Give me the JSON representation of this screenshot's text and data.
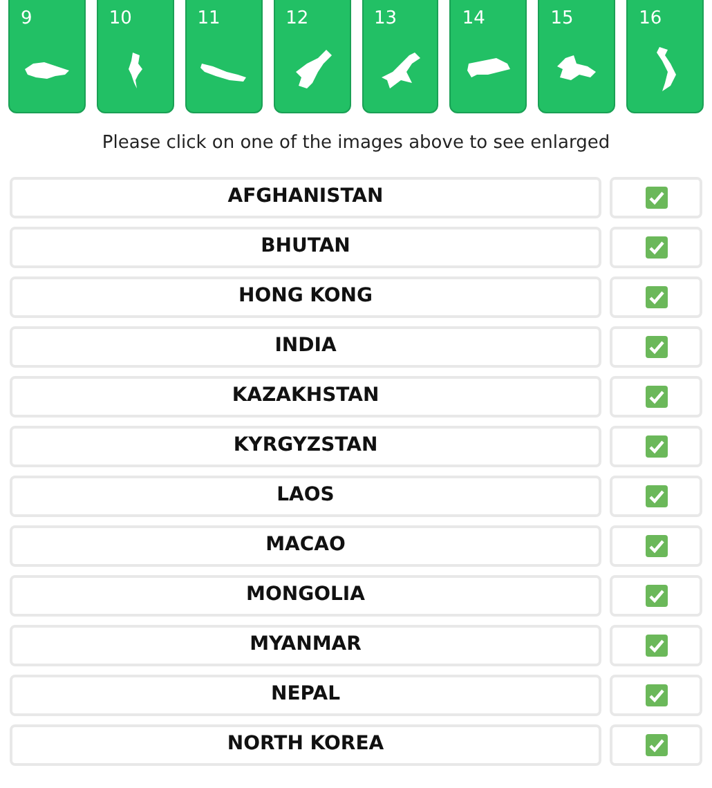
{
  "cards": [
    {
      "number": "9"
    },
    {
      "number": "10"
    },
    {
      "number": "11"
    },
    {
      "number": "12"
    },
    {
      "number": "13"
    },
    {
      "number": "14"
    },
    {
      "number": "15"
    },
    {
      "number": "16"
    }
  ],
  "instruction": "Please click on one of the images above to see enlarged",
  "answers": [
    {
      "name": "AFGHANISTAN",
      "checked": true
    },
    {
      "name": "BHUTAN",
      "checked": true
    },
    {
      "name": "HONG KONG",
      "checked": true
    },
    {
      "name": "INDIA",
      "checked": true
    },
    {
      "name": "KAZAKHSTAN",
      "checked": true
    },
    {
      "name": "KYRGYZSTAN",
      "checked": true
    },
    {
      "name": "LAOS",
      "checked": true
    },
    {
      "name": "MACAO",
      "checked": true
    },
    {
      "name": "MONGOLIA",
      "checked": true
    },
    {
      "name": "MYANMAR",
      "checked": true
    },
    {
      "name": "NEPAL",
      "checked": true
    },
    {
      "name": "NORTH KOREA",
      "checked": true
    }
  ]
}
